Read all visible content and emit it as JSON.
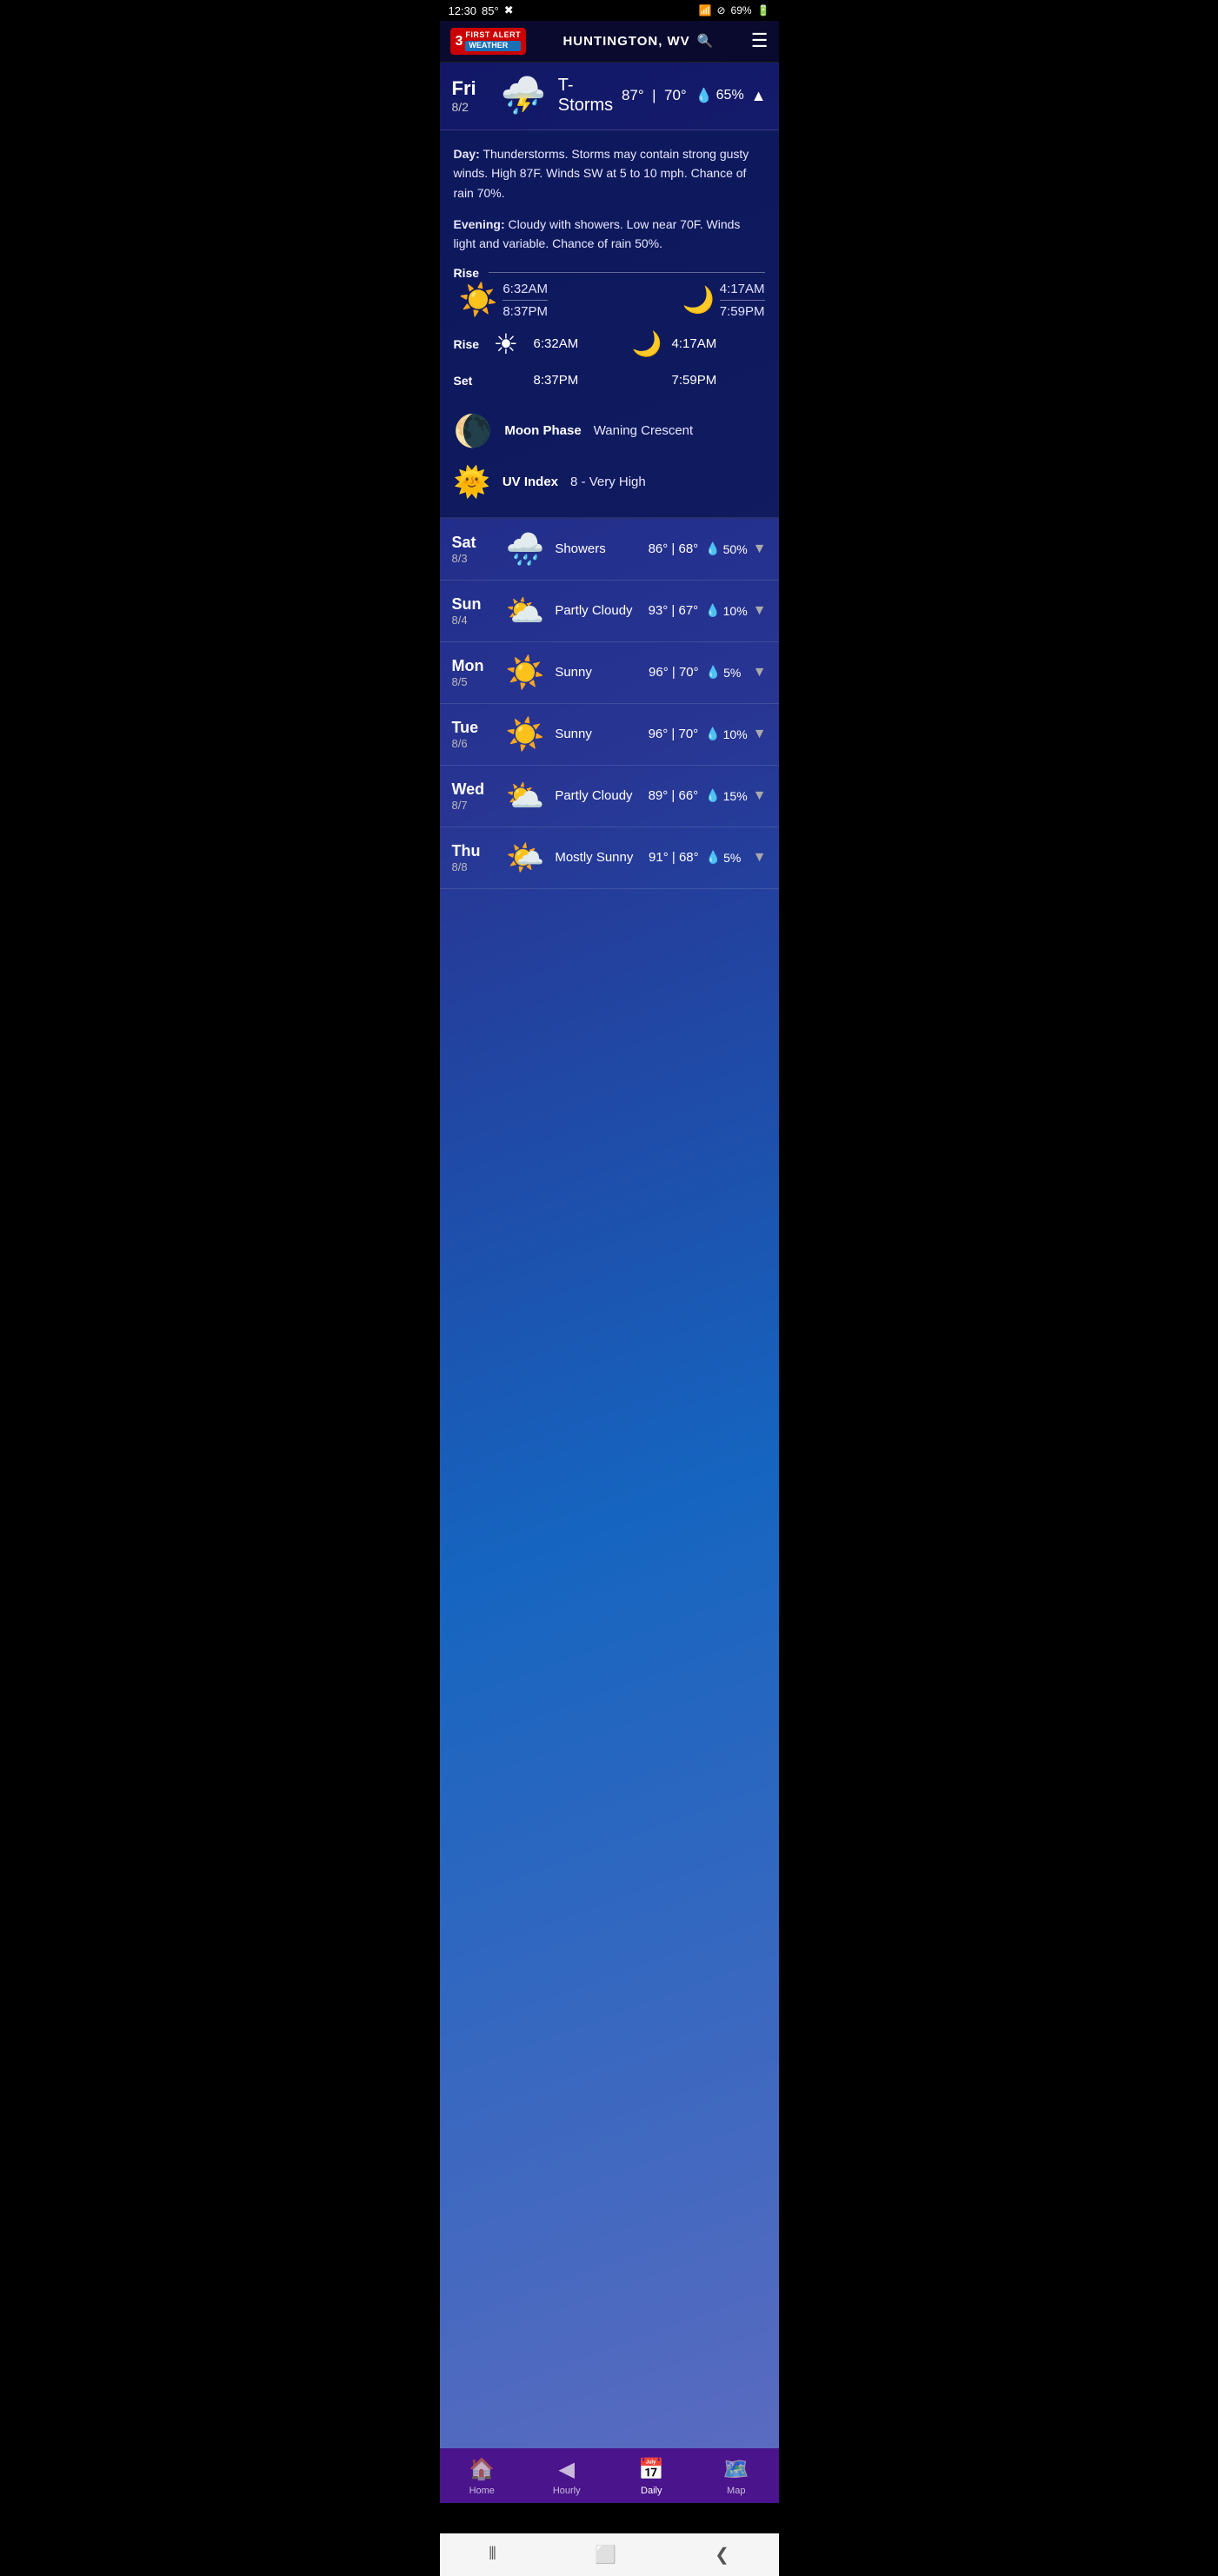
{
  "statusBar": {
    "time": "12:30",
    "temp": "85°",
    "batteryPercent": "69%",
    "wifiIcon": "wifi",
    "batteryIcon": "battery"
  },
  "header": {
    "logo": {
      "channel": "3",
      "firstAlert": "FIRST ALERT",
      "weather": "WEATHER"
    },
    "city": "HUNTINGTON, WV",
    "searchIcon": "🔍",
    "menuIcon": "☰"
  },
  "today": {
    "dayName": "Fri",
    "dayDate": "8/2",
    "icon": "⛈️",
    "condition": "T-Storms",
    "high": "87°",
    "low": "70°",
    "precipChance": "65%",
    "expanded": true
  },
  "detail": {
    "dayText": "Thunderstorms. Storms may contain strong gusty winds. High 87F. Winds SW at 5 to 10 mph. Chance of rain 70%.",
    "eveningText": "Cloudy with showers. Low near 70F. Winds light and variable. Chance of rain 50%.",
    "sunRise": "6:32AM",
    "sunSet": "8:37PM",
    "moonRise": "4:17AM",
    "moonSet": "7:59PM",
    "moonPhase": "Waning Crescent",
    "uvIndex": "8 - Very High"
  },
  "forecast": [
    {
      "dayName": "Sat",
      "dayDate": "8/3",
      "icon": "🌧️",
      "condition": "Showers",
      "high": "86°",
      "low": "68°",
      "precipChance": "50%"
    },
    {
      "dayName": "Sun",
      "dayDate": "8/4",
      "icon": "⛅",
      "condition": "Partly Cloudy",
      "high": "93°",
      "low": "67°",
      "precipChance": "10%"
    },
    {
      "dayName": "Mon",
      "dayDate": "8/5",
      "icon": "☀️",
      "condition": "Sunny",
      "high": "96°",
      "low": "70°",
      "precipChance": "5%"
    },
    {
      "dayName": "Tue",
      "dayDate": "8/6",
      "icon": "☀️",
      "condition": "Sunny",
      "high": "96°",
      "low": "70°",
      "precipChance": "10%"
    },
    {
      "dayName": "Wed",
      "dayDate": "8/7",
      "icon": "⛅",
      "condition": "Partly Cloudy",
      "high": "89°",
      "low": "66°",
      "precipChance": "15%"
    },
    {
      "dayName": "Thu",
      "dayDate": "8/8",
      "icon": "🌤️",
      "condition": "Mostly Sunny",
      "high": "91°",
      "low": "68°",
      "precipChance": "5%"
    }
  ],
  "bottomNav": [
    {
      "icon": "🏠",
      "label": "Home",
      "active": false
    },
    {
      "icon": "🕐",
      "label": "Hourly",
      "active": false
    },
    {
      "icon": "📅",
      "label": "Daily",
      "active": true
    },
    {
      "icon": "🗺️",
      "label": "Map",
      "active": false
    }
  ],
  "androidNav": {
    "back": "❮",
    "home": "⬜",
    "recents": "⦀"
  }
}
